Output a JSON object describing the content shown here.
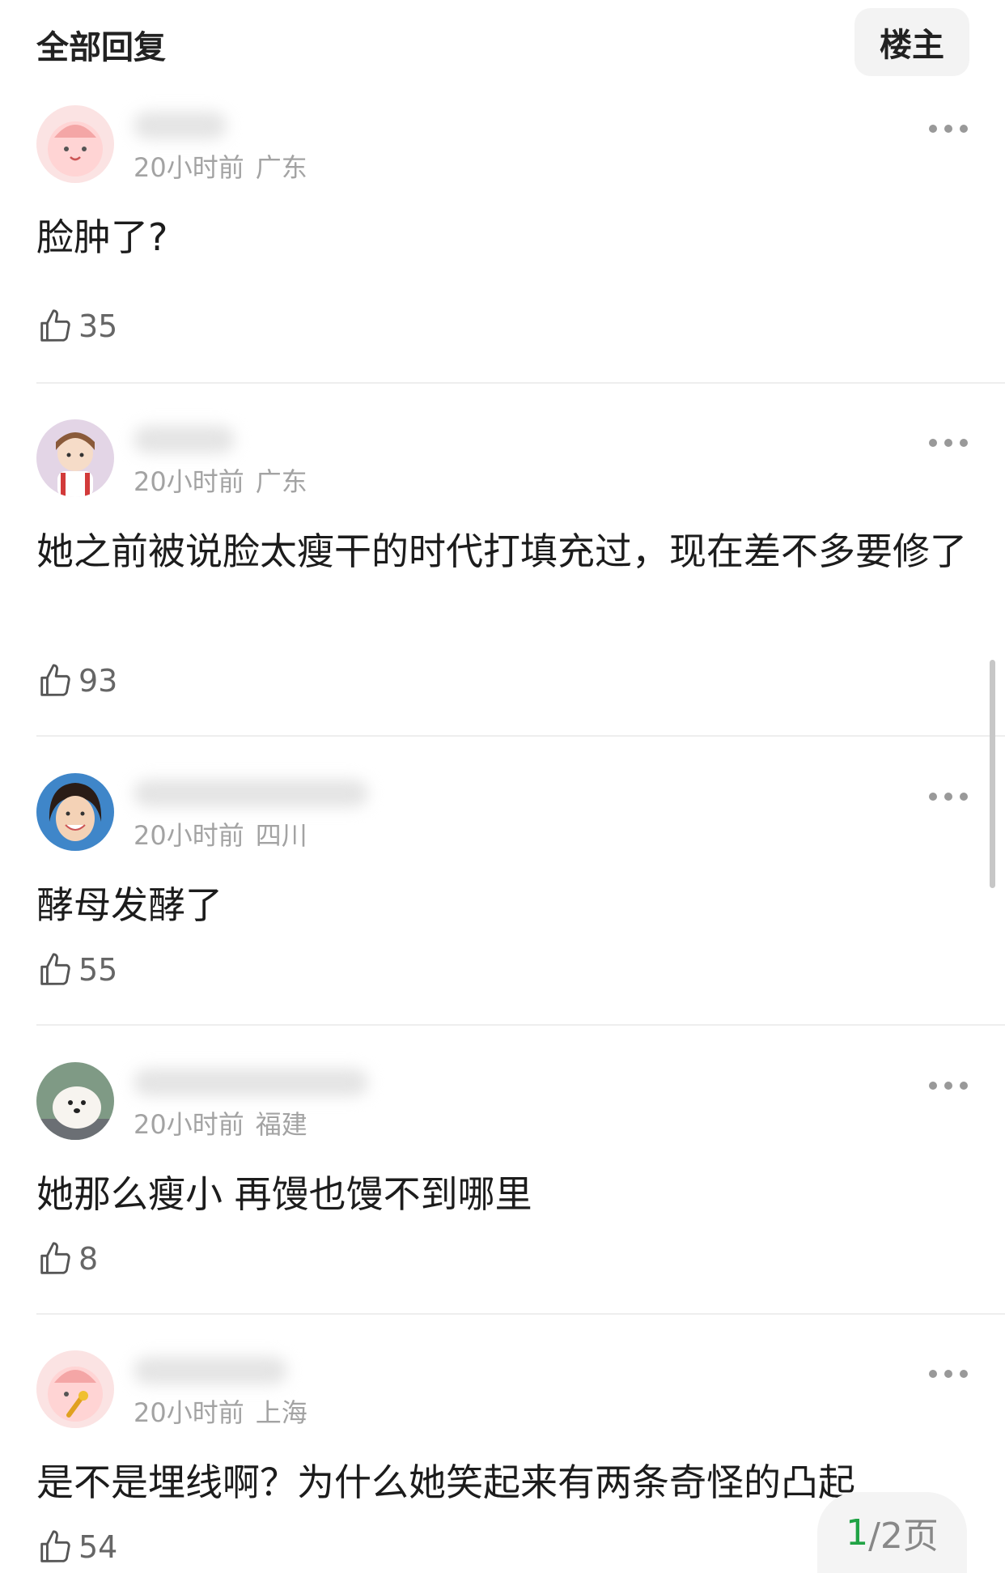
{
  "header": {
    "title": "全部回复",
    "filter_button": "楼主"
  },
  "comments": [
    {
      "time": "20小时前",
      "location": "广东",
      "text": "脸肿了?",
      "likes": "35"
    },
    {
      "time": "20小时前",
      "location": "广东",
      "text": "她之前被说脸太瘦干的时代打填充过，现在差不多要修了",
      "likes": "93"
    },
    {
      "time": "20小时前",
      "location": "四川",
      "text": "酵母发酵了",
      "likes": "55"
    },
    {
      "time": "20小时前",
      "location": "福建",
      "text": "她那么瘦小 再馒也馒不到哪里",
      "likes": "8"
    },
    {
      "time": "20小时前",
      "location": "上海",
      "text": "是不是埋线啊？为什么她笑起来有两条奇怪的凸起",
      "likes": "54"
    }
  ],
  "pagination": {
    "current": "1",
    "rest": "/2页"
  },
  "colors": {
    "accent_green": "#20a345",
    "meta_gray": "#a3a3a3",
    "divider": "#eeeeee"
  }
}
